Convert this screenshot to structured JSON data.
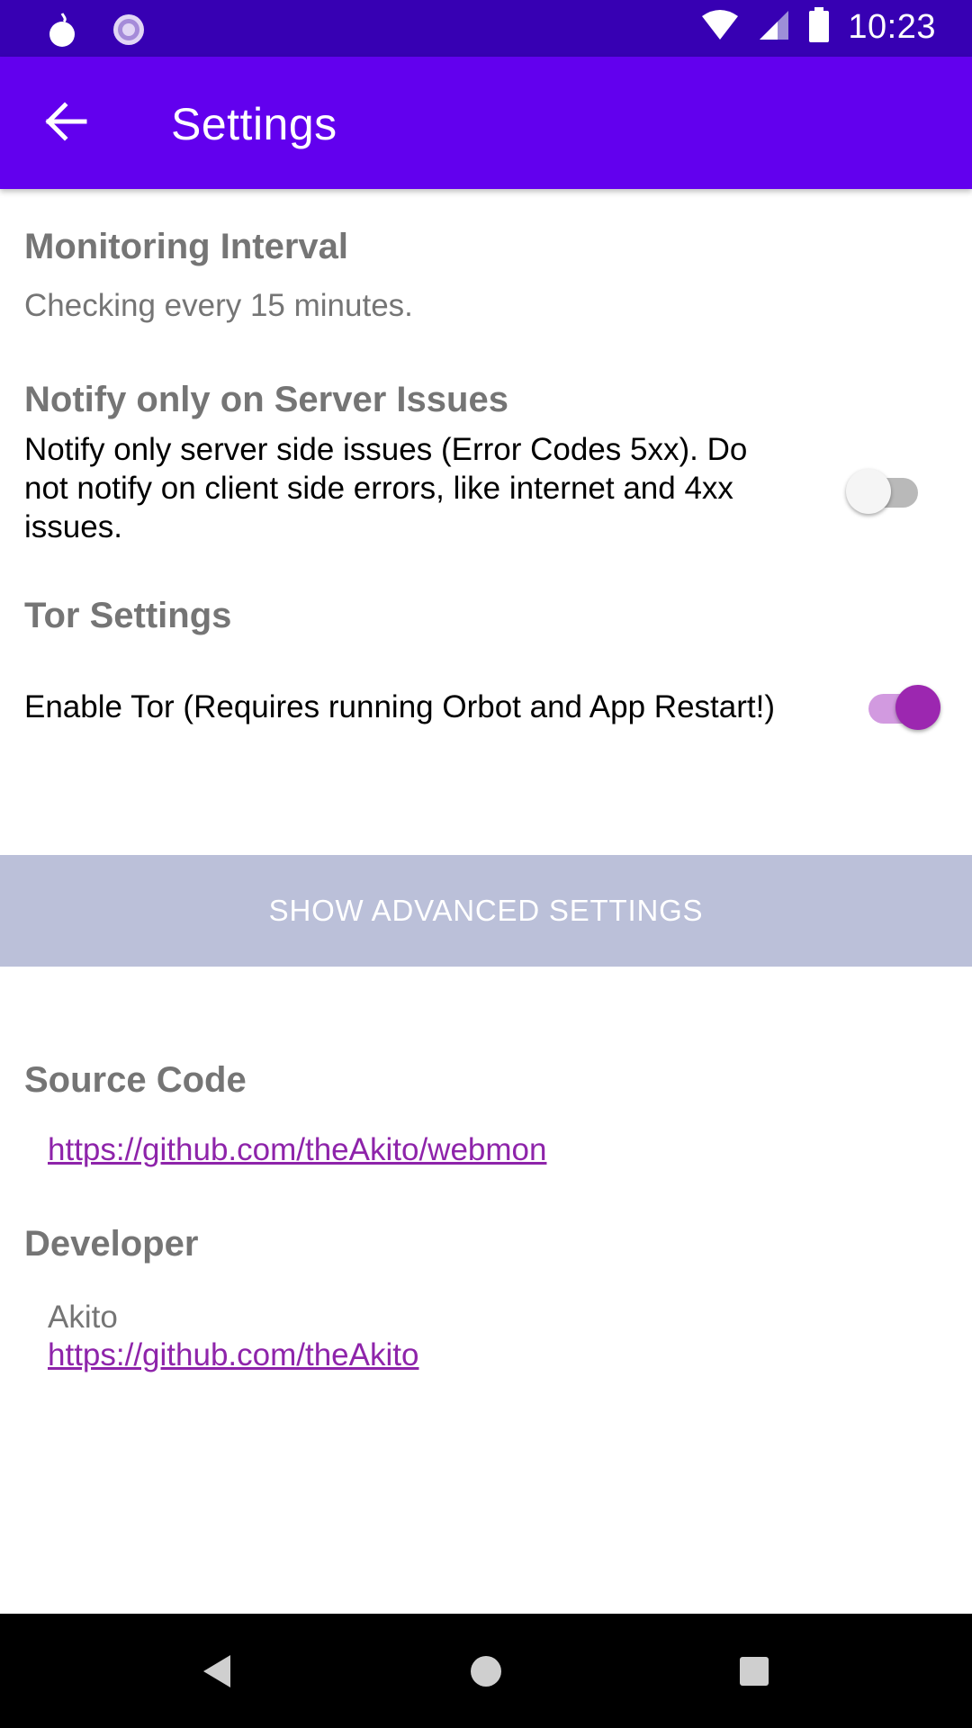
{
  "status_bar": {
    "time": "10:23",
    "icons": [
      "tor-onion-icon",
      "orbot-icon",
      "wifi-icon",
      "cell-signal-icon",
      "battery-icon"
    ]
  },
  "app_bar": {
    "title": "Settings",
    "back_icon": "arrow-back-icon"
  },
  "monitoring": {
    "title": "Monitoring Interval",
    "summary": "Checking every 15 minutes."
  },
  "notify": {
    "title": "Notify only on Server Issues",
    "line1": "Notify only server side issues (Error Codes 5xx). Do",
    "line2": "not notify on client side errors, like internet and 4xx",
    "line3": "issues.",
    "enabled": false
  },
  "tor": {
    "title": "Tor Settings",
    "label": "Enable Tor (Requires running Orbot and App Restart!)",
    "enabled": true
  },
  "advanced_button": {
    "label": "SHOW ADVANCED SETTINGS"
  },
  "source_code": {
    "title": "Source Code",
    "url": "https://github.com/theAkito/webmon"
  },
  "developer": {
    "title": "Developer",
    "name": "Akito",
    "url": "https://github.com/theAkito"
  },
  "colors": {
    "status_bar": "#3700b3",
    "app_bar": "#6200ee",
    "accent": "#9c27b0",
    "button_bg": "#bbc0d9"
  }
}
